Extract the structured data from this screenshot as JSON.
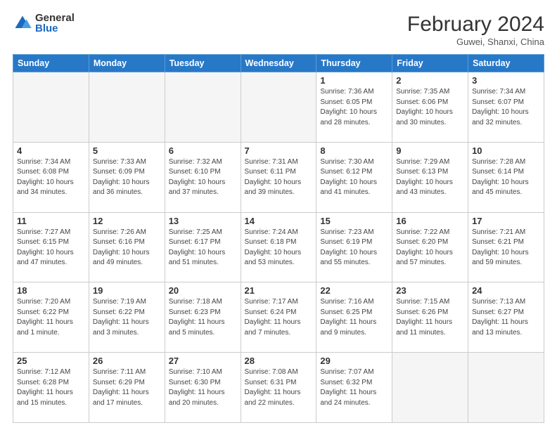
{
  "header": {
    "logo_general": "General",
    "logo_blue": "Blue",
    "month_title": "February 2024",
    "location": "Guwei, Shanxi, China"
  },
  "calendar": {
    "days_of_week": [
      "Sunday",
      "Monday",
      "Tuesday",
      "Wednesday",
      "Thursday",
      "Friday",
      "Saturday"
    ],
    "weeks": [
      [
        {
          "day": "",
          "info": ""
        },
        {
          "day": "",
          "info": ""
        },
        {
          "day": "",
          "info": ""
        },
        {
          "day": "",
          "info": ""
        },
        {
          "day": "1",
          "info": "Sunrise: 7:36 AM\nSunset: 6:05 PM\nDaylight: 10 hours and 28 minutes."
        },
        {
          "day": "2",
          "info": "Sunrise: 7:35 AM\nSunset: 6:06 PM\nDaylight: 10 hours and 30 minutes."
        },
        {
          "day": "3",
          "info": "Sunrise: 7:34 AM\nSunset: 6:07 PM\nDaylight: 10 hours and 32 minutes."
        }
      ],
      [
        {
          "day": "4",
          "info": "Sunrise: 7:34 AM\nSunset: 6:08 PM\nDaylight: 10 hours and 34 minutes."
        },
        {
          "day": "5",
          "info": "Sunrise: 7:33 AM\nSunset: 6:09 PM\nDaylight: 10 hours and 36 minutes."
        },
        {
          "day": "6",
          "info": "Sunrise: 7:32 AM\nSunset: 6:10 PM\nDaylight: 10 hours and 37 minutes."
        },
        {
          "day": "7",
          "info": "Sunrise: 7:31 AM\nSunset: 6:11 PM\nDaylight: 10 hours and 39 minutes."
        },
        {
          "day": "8",
          "info": "Sunrise: 7:30 AM\nSunset: 6:12 PM\nDaylight: 10 hours and 41 minutes."
        },
        {
          "day": "9",
          "info": "Sunrise: 7:29 AM\nSunset: 6:13 PM\nDaylight: 10 hours and 43 minutes."
        },
        {
          "day": "10",
          "info": "Sunrise: 7:28 AM\nSunset: 6:14 PM\nDaylight: 10 hours and 45 minutes."
        }
      ],
      [
        {
          "day": "11",
          "info": "Sunrise: 7:27 AM\nSunset: 6:15 PM\nDaylight: 10 hours and 47 minutes."
        },
        {
          "day": "12",
          "info": "Sunrise: 7:26 AM\nSunset: 6:16 PM\nDaylight: 10 hours and 49 minutes."
        },
        {
          "day": "13",
          "info": "Sunrise: 7:25 AM\nSunset: 6:17 PM\nDaylight: 10 hours and 51 minutes."
        },
        {
          "day": "14",
          "info": "Sunrise: 7:24 AM\nSunset: 6:18 PM\nDaylight: 10 hours and 53 minutes."
        },
        {
          "day": "15",
          "info": "Sunrise: 7:23 AM\nSunset: 6:19 PM\nDaylight: 10 hours and 55 minutes."
        },
        {
          "day": "16",
          "info": "Sunrise: 7:22 AM\nSunset: 6:20 PM\nDaylight: 10 hours and 57 minutes."
        },
        {
          "day": "17",
          "info": "Sunrise: 7:21 AM\nSunset: 6:21 PM\nDaylight: 10 hours and 59 minutes."
        }
      ],
      [
        {
          "day": "18",
          "info": "Sunrise: 7:20 AM\nSunset: 6:22 PM\nDaylight: 11 hours and 1 minute."
        },
        {
          "day": "19",
          "info": "Sunrise: 7:19 AM\nSunset: 6:22 PM\nDaylight: 11 hours and 3 minutes."
        },
        {
          "day": "20",
          "info": "Sunrise: 7:18 AM\nSunset: 6:23 PM\nDaylight: 11 hours and 5 minutes."
        },
        {
          "day": "21",
          "info": "Sunrise: 7:17 AM\nSunset: 6:24 PM\nDaylight: 11 hours and 7 minutes."
        },
        {
          "day": "22",
          "info": "Sunrise: 7:16 AM\nSunset: 6:25 PM\nDaylight: 11 hours and 9 minutes."
        },
        {
          "day": "23",
          "info": "Sunrise: 7:15 AM\nSunset: 6:26 PM\nDaylight: 11 hours and 11 minutes."
        },
        {
          "day": "24",
          "info": "Sunrise: 7:13 AM\nSunset: 6:27 PM\nDaylight: 11 hours and 13 minutes."
        }
      ],
      [
        {
          "day": "25",
          "info": "Sunrise: 7:12 AM\nSunset: 6:28 PM\nDaylight: 11 hours and 15 minutes."
        },
        {
          "day": "26",
          "info": "Sunrise: 7:11 AM\nSunset: 6:29 PM\nDaylight: 11 hours and 17 minutes."
        },
        {
          "day": "27",
          "info": "Sunrise: 7:10 AM\nSunset: 6:30 PM\nDaylight: 11 hours and 20 minutes."
        },
        {
          "day": "28",
          "info": "Sunrise: 7:08 AM\nSunset: 6:31 PM\nDaylight: 11 hours and 22 minutes."
        },
        {
          "day": "29",
          "info": "Sunrise: 7:07 AM\nSunset: 6:32 PM\nDaylight: 11 hours and 24 minutes."
        },
        {
          "day": "",
          "info": ""
        },
        {
          "day": "",
          "info": ""
        }
      ]
    ]
  }
}
